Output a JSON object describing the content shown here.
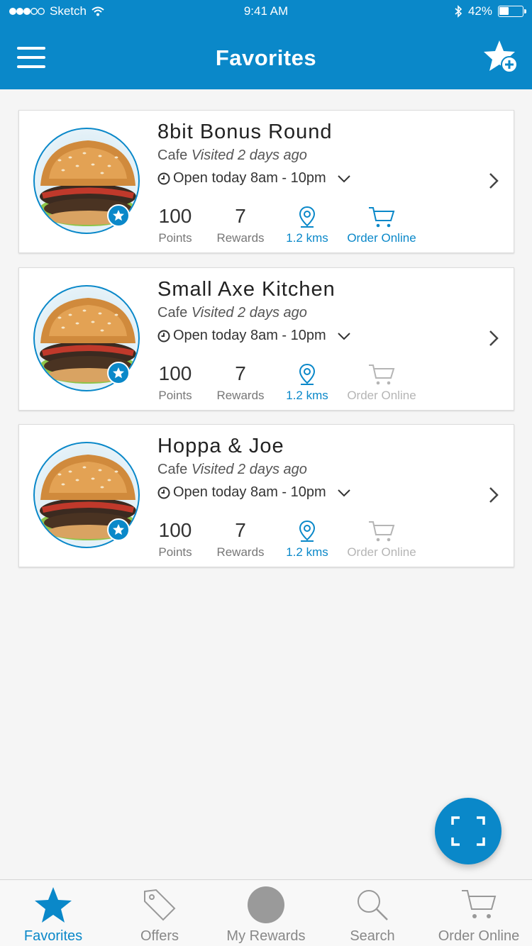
{
  "status_bar": {
    "carrier": "Sketch",
    "time": "9:41 AM",
    "battery": "42%"
  },
  "header": {
    "title": "Favorites"
  },
  "colors": {
    "accent": "#0a88c9",
    "disabled": "#b5b5b5"
  },
  "favorites": [
    {
      "name": "8bit Bonus Round",
      "category": "Cafe",
      "visited": "Visited 2 days ago",
      "hours": "Open today 8am - 10pm",
      "points_value": "100",
      "points_label": "Points",
      "rewards_value": "7",
      "rewards_label": "Rewards",
      "distance": "1.2 kms",
      "order_label": "Order Online",
      "order_enabled": true
    },
    {
      "name": "Small Axe Kitchen",
      "category": "Cafe",
      "visited": "Visited 2 days ago",
      "hours": "Open today 8am - 10pm",
      "points_value": "100",
      "points_label": "Points",
      "rewards_value": "7",
      "rewards_label": "Rewards",
      "distance": "1.2 kms",
      "order_label": "Order Online",
      "order_enabled": false
    },
    {
      "name": "Hoppa & Joe",
      "category": "Cafe",
      "visited": "Visited 2 days ago",
      "hours": "Open today 8am - 10pm",
      "points_value": "100",
      "points_label": "Points",
      "rewards_value": "7",
      "rewards_label": "Rewards",
      "distance": "1.2 kms",
      "order_label": "Order Online",
      "order_enabled": false
    }
  ],
  "tabs": [
    {
      "label": "Favorites",
      "icon": "star-icon",
      "active": true
    },
    {
      "label": "Offers",
      "icon": "tag-icon",
      "active": false
    },
    {
      "label": "My Rewards",
      "icon": "rewards-circle-icon",
      "active": false
    },
    {
      "label": "Search",
      "icon": "search-icon",
      "active": false
    },
    {
      "label": "Order Online",
      "icon": "cart-icon",
      "active": false
    }
  ]
}
